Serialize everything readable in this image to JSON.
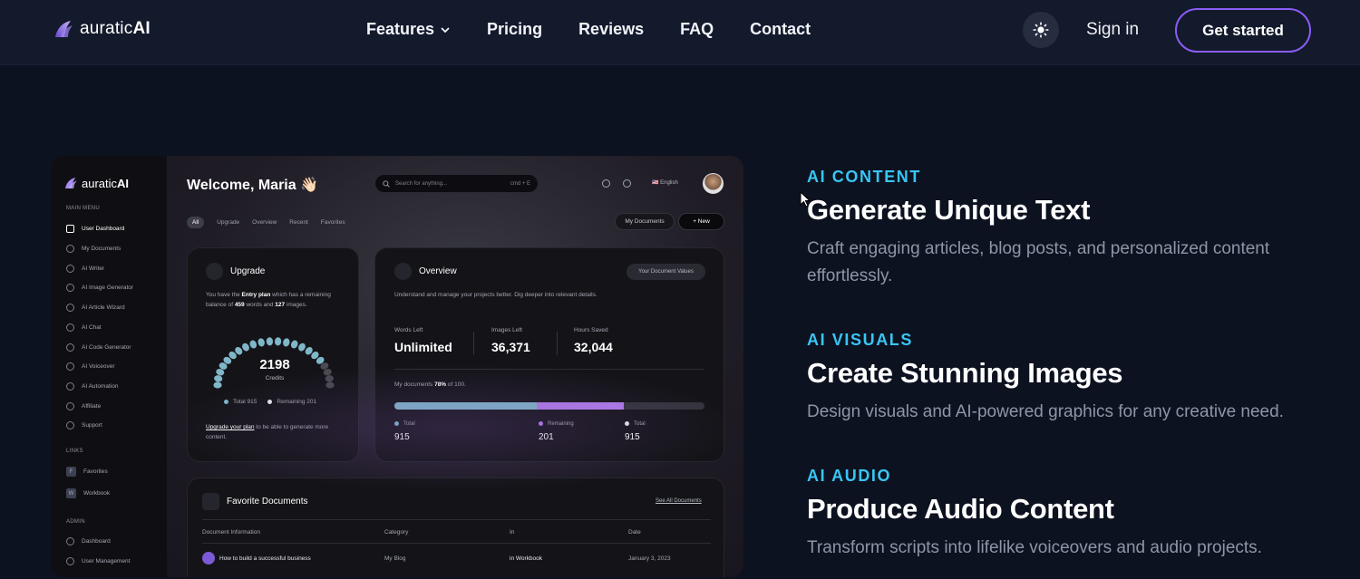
{
  "nav": {
    "brand_light": "auratic",
    "brand_bold": "AI",
    "links": [
      {
        "label": "Features",
        "has_dropdown": true
      },
      {
        "label": "Pricing"
      },
      {
        "label": "Reviews"
      },
      {
        "label": "FAQ"
      },
      {
        "label": "Contact"
      }
    ],
    "theme_icon": "sun-icon",
    "signin": "Sign in",
    "cta": "Get started",
    "colors": {
      "cta_border": "#8b5cf6",
      "accent": "#38c6f4"
    }
  },
  "mock": {
    "brand_light": "auratic",
    "brand_bold": "AI",
    "welcome": "Welcome, Maria 👋🏻",
    "search_placeholder": "Search for anything...",
    "search_shortcut": "cmd + E",
    "language": "🇺🇸 English",
    "sidebar": {
      "main_menu": "MAIN MENU",
      "items": [
        "User Dashboard",
        "My Documents",
        "AI Writer",
        "AI Image Generator",
        "AI Article Wizard",
        "AI Chat",
        "AI Code Generator",
        "AI Voiceover",
        "AI Automation",
        "Affiliate",
        "Support"
      ],
      "links_title": "LINKS",
      "links": [
        {
          "initial": "F",
          "label": "Favorites"
        },
        {
          "initial": "W",
          "label": "Workbook"
        }
      ],
      "admin_title": "ADMIN",
      "admin": [
        "Dashboard",
        "User Management"
      ]
    },
    "tabs": [
      "All",
      "Upgrade",
      "Overview",
      "Recent",
      "Favorites"
    ],
    "btn_docs": "My Documents",
    "btn_new": "+  New",
    "upgrade": {
      "title": "Upgrade",
      "text_1": "You have the ",
      "plan": "Entry plan",
      "text_2": " which has a remaining balance of ",
      "words": "459",
      "text_3": " words and ",
      "images": "127",
      "text_4": " images.",
      "credits_value": "2198",
      "credits_label": "Credits",
      "used_fraction": 0.82,
      "legend_total": "Total",
      "legend_total_val": "915",
      "legend_remaining": "Remaining",
      "legend_remaining_val": "201",
      "link": "Upgrade your plan",
      "link_rest": " to be able to generate more content."
    },
    "overview": {
      "title": "Overview",
      "pill": "Your Document Values",
      "desc": "Understand and manage your projects better. Dig deeper into relevant details.",
      "stats": [
        {
          "label": "Words Left",
          "value": "Unlimited"
        },
        {
          "label": "Images Left",
          "value": "36,371"
        },
        {
          "label": "Hours Saved",
          "value": "32,044"
        }
      ],
      "progress_text_1": "My documents ",
      "progress_pct": "78%",
      "progress_text_2": " of 100.",
      "seg_a": 0.46,
      "seg_b": 0.28,
      "legend": [
        {
          "label": "Total",
          "value": "915",
          "color": "#7fb7c9"
        },
        {
          "label": "Remaining",
          "value": "201",
          "color": "#b07bea"
        },
        {
          "label": "Total",
          "value": "915",
          "color": "#e5e7ee"
        }
      ]
    },
    "favorites": {
      "title": "Favorite Documents",
      "see_all": "See All Documents",
      "headers": [
        "Document Information",
        "Category",
        "In",
        "Date"
      ],
      "row": [
        "How to build a successful business",
        "My Blog",
        "in Workbook",
        "January 3, 2023"
      ]
    }
  },
  "features": [
    {
      "eyebrow": "AI CONTENT",
      "title": "Generate Unique Text",
      "desc": "Craft engaging articles, blog posts, and personalized content effortlessly."
    },
    {
      "eyebrow": "AI VISUALS",
      "title": "Create Stunning Images",
      "desc": "Design visuals and AI-powered graphics for any creative need."
    },
    {
      "eyebrow": "AI AUDIO",
      "title": "Produce Audio Content",
      "desc": "Transform scripts into lifelike voiceovers and audio projects."
    }
  ]
}
